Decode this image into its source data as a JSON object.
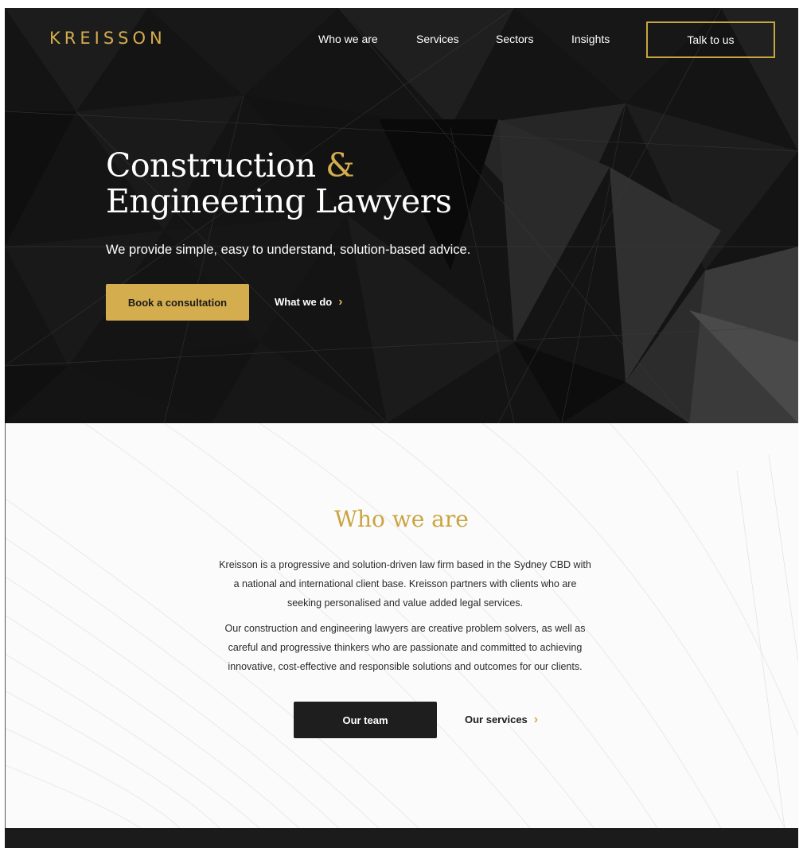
{
  "brand": {
    "logo": "KREISSON",
    "accent": "#d4ad4e",
    "dark": "#1e1e1e"
  },
  "nav": {
    "items": [
      {
        "label": "Who we are"
      },
      {
        "label": "Services"
      },
      {
        "label": "Sectors"
      },
      {
        "label": "Insights"
      }
    ],
    "cta_label": "Talk to us"
  },
  "hero": {
    "title_line1": "Construction ",
    "title_amp": "&",
    "title_line2": "Engineering Lawyers",
    "subtitle": "We provide simple, easy to understand, solution-based advice.",
    "primary_label": "Book a consultation",
    "secondary_label": "What we do"
  },
  "who": {
    "title": "Who we are",
    "paragraph1": "Kreisson is a progressive and solution-driven law firm based in the Sydney CBD with a national and international client base. Kreisson partners with clients who are seeking personalised and value added legal services.",
    "paragraph2": "Our construction and engineering lawyers are creative problem solvers, as well as careful and progressive thinkers who are passionate and committed to achieving innovative, cost-effective and responsible solutions and outcomes for our clients.",
    "primary_label": "Our team",
    "secondary_label": "Our services"
  },
  "icons": {
    "chevron": "chevron-right-icon"
  }
}
